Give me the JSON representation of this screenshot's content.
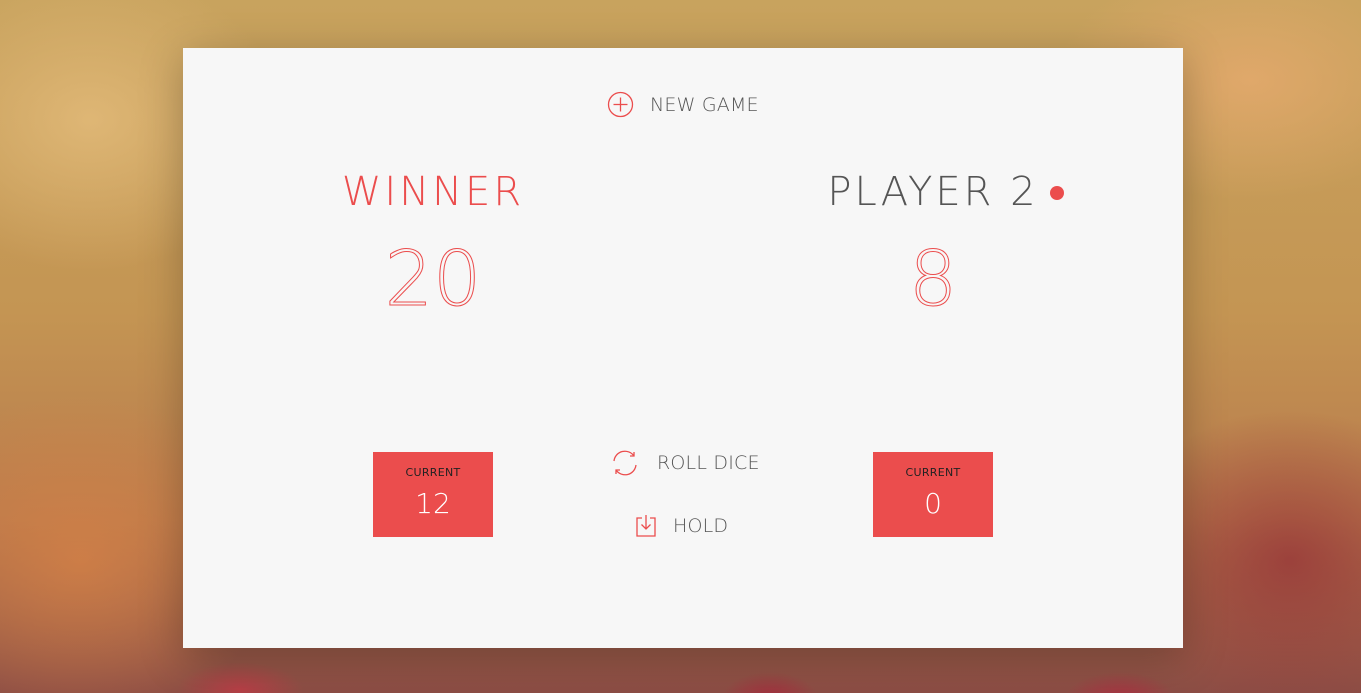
{
  "controls": {
    "new_game_label": "NEW GAME",
    "roll_dice_label": "ROLL DICE",
    "hold_label": "HOLD"
  },
  "players": [
    {
      "name": "WINNER",
      "score": "20",
      "current_label": "CURRENT",
      "current_score": "12",
      "active": false
    },
    {
      "name": "PLAYER 2",
      "score": "8",
      "current_label": "CURRENT",
      "current_score": "0",
      "active": true
    }
  ],
  "colors": {
    "accent": "#eb4d4d",
    "text": "#555555",
    "panel": "#f7f7f7"
  },
  "icons": {
    "new_game": "plus-circle-icon",
    "roll_dice": "refresh-icon",
    "hold": "download-box-icon",
    "active_player": "active-dot"
  }
}
